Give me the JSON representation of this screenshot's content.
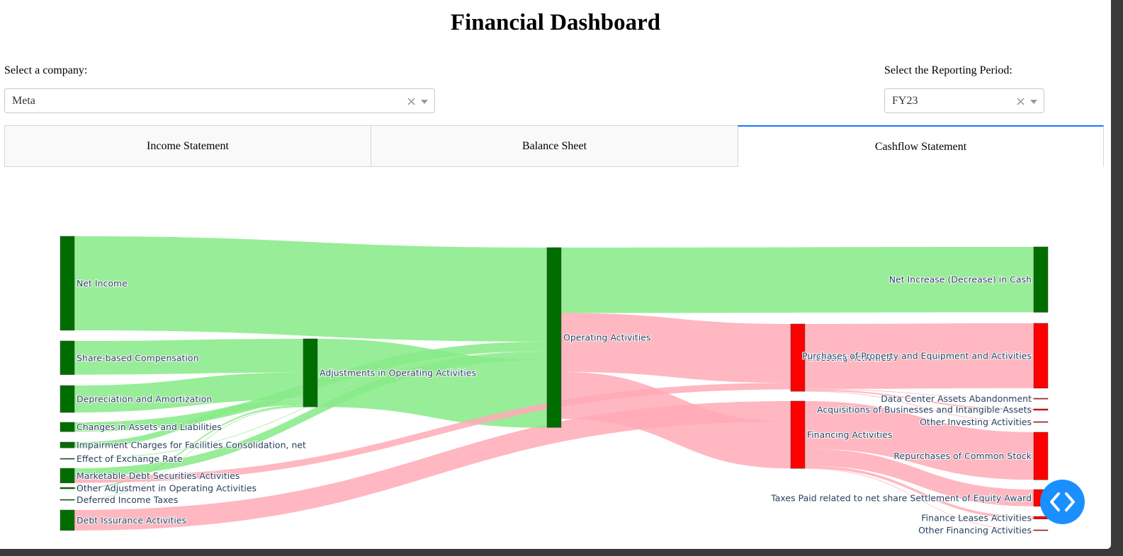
{
  "page": {
    "title": "Financial Dashboard"
  },
  "company_select": {
    "label": "Select a company:",
    "value": "Meta",
    "clear_icon": "×"
  },
  "period_select": {
    "label": "Select the Reporting Period:",
    "value": "FY23",
    "clear_icon": "×"
  },
  "tabs": [
    {
      "label": "Income Statement",
      "active": false
    },
    {
      "label": "Balance Sheet",
      "active": false
    },
    {
      "label": "Cashflow Statement",
      "active": true
    }
  ],
  "colors": {
    "inflow_node": "#006d00",
    "outflow_node": "#ff0000",
    "inflow_link": "#86ea86",
    "outflow_link": "#ffaab6",
    "tab_accent": "#1975fa",
    "fab": "#1a8fff"
  },
  "chart_data": {
    "type": "sankey",
    "nodes": [
      {
        "label": "Net Income",
        "color": "green"
      },
      {
        "label": "Share-based Compensation",
        "color": "green"
      },
      {
        "label": "Depreciation and Amortization",
        "color": "green"
      },
      {
        "label": "Changes in Assets and Liabilities",
        "color": "green"
      },
      {
        "label": "Impairment Charges for Facilities Consolidation, net",
        "color": "green"
      },
      {
        "label": "Effect of Exchange Rate",
        "color": "green"
      },
      {
        "label": "Marketable Debt Securities Activities",
        "color": "green"
      },
      {
        "label": "Other Adjustment in Operating Activities",
        "color": "green"
      },
      {
        "label": "Deferred Income Taxes",
        "color": "green"
      },
      {
        "label": "Debt Issurance Activities",
        "color": "green"
      },
      {
        "label": "Adjustments in Operating Activities",
        "color": "green"
      },
      {
        "label": "Operating Activities",
        "color": "green"
      },
      {
        "label": "Investing Activities",
        "color": "red"
      },
      {
        "label": "Financing Activities",
        "color": "red"
      },
      {
        "label": "Net Increase (Decrease) in Cash",
        "color": "green"
      },
      {
        "label": "Purchases of Property and Equipment and Activities",
        "color": "red"
      },
      {
        "label": "Data Center Assets Abandonment",
        "color": "red"
      },
      {
        "label": "Acquisitions of Businesses and Intangible Assets",
        "color": "red"
      },
      {
        "label": "Other Investing Activities",
        "color": "red"
      },
      {
        "label": "Repurchases of Common Stock",
        "color": "red"
      },
      {
        "label": "Taxes Paid related to net share Settlement of Equity Award",
        "color": "red"
      },
      {
        "label": "Finance Leases Activities",
        "color": "red"
      },
      {
        "label": "Other Financing Activities",
        "color": "red"
      }
    ],
    "links": [
      {
        "source": "Net Income",
        "target": "Operating Activities",
        "value": 39.1
      },
      {
        "source": "Share-based Compensation",
        "target": "Adjustments in Operating Activities",
        "value": 14.0
      },
      {
        "source": "Depreciation and Amortization",
        "target": "Adjustments in Operating Activities",
        "value": 11.2
      },
      {
        "source": "Changes in Assets and Liabilities",
        "target": "Operating Activities",
        "value": 3.9
      },
      {
        "source": "Impairment Charges for Facilities Consolidation, net",
        "target": "Adjustments in Operating Activities",
        "value": 2.4
      },
      {
        "source": "Effect of Exchange Rate",
        "target": "Operating Activities",
        "value": 0.1
      },
      {
        "source": "Marketable Debt Securities Activities",
        "target": "Operating Activities",
        "value": 3.4
      },
      {
        "source": "Other Adjustment in Operating Activities",
        "target": "Adjustments in Operating Activities",
        "value": 0.6
      },
      {
        "source": "Deferred Income Taxes",
        "target": "Adjustments in Operating Activities",
        "value": 0.1
      },
      {
        "source": "Debt Issurance Activities",
        "target": "Financing Activities",
        "value": 8.5
      },
      {
        "source": "Adjustments in Operating Activities",
        "target": "Operating Activities",
        "value": 28.3
      },
      {
        "source": "Operating Activities",
        "target": "Net Increase (Decrease) in Cash",
        "value": 27.2
      },
      {
        "source": "Operating Activities",
        "target": "Investing Activities",
        "value": 24.5
      },
      {
        "source": "Operating Activities",
        "target": "Financing Activities",
        "value": 19.5
      },
      {
        "source": "Marketable Debt Securities Activities",
        "target": "Investing Activities",
        "value": 2.7
      },
      {
        "source": "Investing Activities",
        "target": "Purchases of Property and Equipment and Activities",
        "value": 27.0
      },
      {
        "source": "Investing Activities",
        "target": "Data Center Assets Abandonment",
        "value": 0.2
      },
      {
        "source": "Investing Activities",
        "target": "Acquisitions of Businesses and Intangible Assets",
        "value": 0.6
      },
      {
        "source": "Investing Activities",
        "target": "Other Investing Activities",
        "value": 0.2
      },
      {
        "source": "Financing Activities",
        "target": "Repurchases of Common Stock",
        "value": 19.8
      },
      {
        "source": "Financing Activities",
        "target": "Taxes Paid related to net share Settlement of Equity Award",
        "value": 7.0
      },
      {
        "source": "Financing Activities",
        "target": "Finance Leases Activities",
        "value": 1.1
      },
      {
        "source": "Financing Activities",
        "target": "Other Financing Activities",
        "value": 0.1
      }
    ]
  }
}
